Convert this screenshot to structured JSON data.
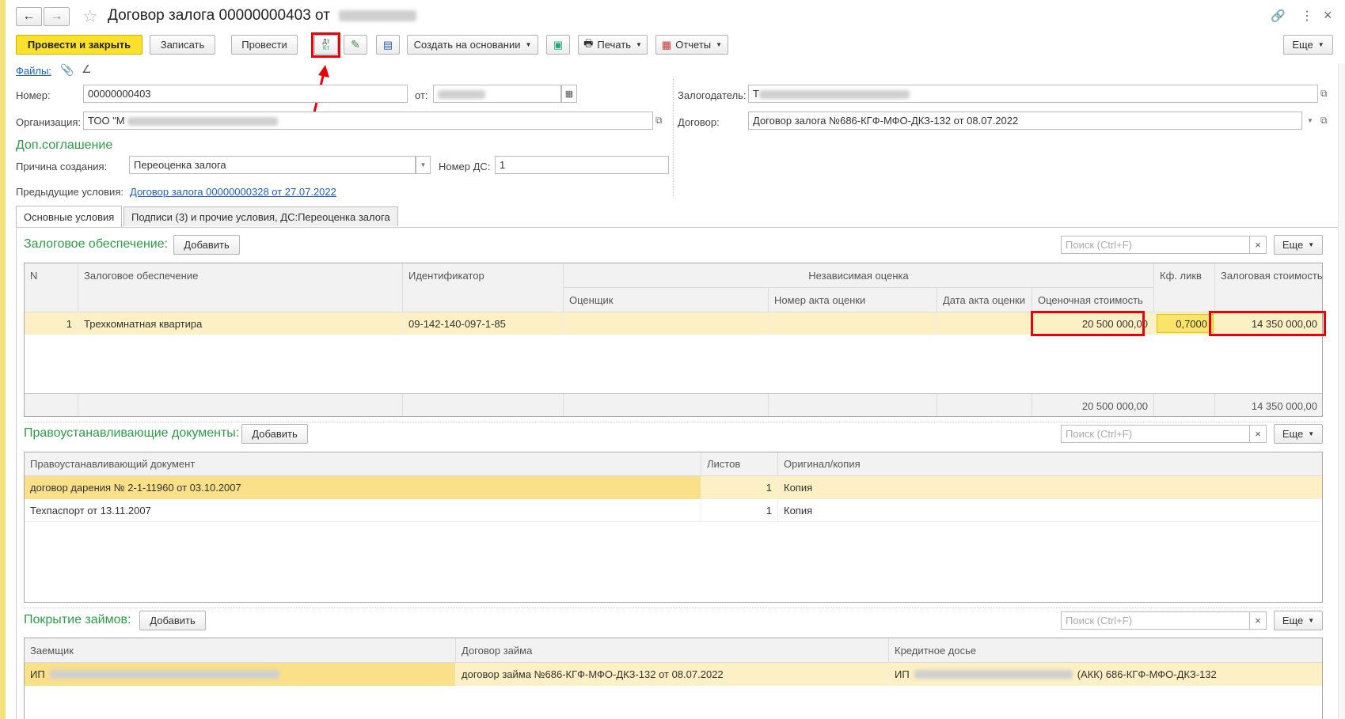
{
  "window": {
    "title": "Договор залога 00000000403 от"
  },
  "toolbar": {
    "post_close": "Провести и закрыть",
    "save": "Записать",
    "post": "Провести",
    "dtkt": "Дт Кт",
    "create_based": "Создать на основании",
    "print": "Печать",
    "reports": "Отчеты",
    "more": "Еще"
  },
  "files": {
    "label": "Файлы:"
  },
  "form": {
    "number_label": "Номер:",
    "number": "00000000403",
    "date_label": "от:",
    "org_label": "Организация:",
    "org_value": "ТОО \"М",
    "pledger_label": "Залогодатель:",
    "pledger_value": "Т",
    "contract_label": "Договор:",
    "contract_value": "Договор залога №686-КГФ-МФО-ДКЗ-132 от 08.07.2022",
    "addl_title": "Доп.соглашение",
    "reason_label": "Причина создания:",
    "reason_value": "Переоценка залога",
    "ds_label": "Номер ДС:",
    "ds_value": "1",
    "prev_label": "Предыдущие условия:",
    "prev_link": "Договор залога 00000000328 от 27.07.2022"
  },
  "tabs": [
    {
      "label": "Основные условия"
    },
    {
      "label": "Подписи (3) и прочие условия, ДС:Переоценка залога"
    }
  ],
  "collateral": {
    "title": "Залоговое обеспечение:",
    "add": "Добавить",
    "search_placeholder": "Поиск (Ctrl+F)",
    "clear": "×",
    "more": "Еще",
    "headers": {
      "n": "N",
      "item": "Залоговое обеспечение",
      "id": "Идентификатор",
      "indep": "Независимая оценка",
      "appraiser": "Оценщик",
      "act_no": "Номер акта оценки",
      "act_date": "Дата акта оценки",
      "est_value": "Оценочная стоимость",
      "kf": "Кф. ликв",
      "pledge_value": "Залоговая стоимость"
    },
    "rows": [
      {
        "n": "1",
        "item": "Трехкомнатная квартира",
        "id": "09-142-140-097-1-85",
        "appraiser": "",
        "act_no": "",
        "act_date": "",
        "est_value": "20 500 000,00",
        "kf": "0,7000",
        "pledge_value": "14 350 000,00"
      }
    ],
    "totals": {
      "est_value": "20 500 000,00",
      "pledge_value": "14 350 000,00"
    }
  },
  "title_docs": {
    "title": "Правоустанавливающие документы:",
    "add": "Добавить",
    "search_placeholder": "Поиск (Ctrl+F)",
    "clear": "×",
    "more": "Еще",
    "headers": {
      "doc": "Правоустанавливающий документ",
      "sheets": "Листов",
      "orig": "Оригинал/копия"
    },
    "rows": [
      {
        "doc": "договор дарения № 2-1-11960 от 03.10.2007",
        "sheets": "1",
        "orig": "Копия"
      },
      {
        "doc": "Техпаспорт от 13.11.2007",
        "sheets": "1",
        "orig": "Копия"
      }
    ]
  },
  "loans": {
    "title": "Покрытие займов:",
    "add": "Добавить",
    "search_placeholder": "Поиск (Ctrl+F)",
    "clear": "×",
    "more": "Еще",
    "headers": {
      "borrower": "Заемщик",
      "loan": "Договор займа",
      "dossier": "Кредитное досье"
    },
    "rows": [
      {
        "borrower": "ИП",
        "loan": "договор займа №686-КГФ-МФО-ДКЗ-132 от 08.07.2022",
        "dossier_prefix": "ИП",
        "dossier_suffix": "(АКК) 686-КГФ-МФО-ДКЗ-132"
      }
    ]
  },
  "colors": {
    "accent_yellow": "#fbe12b",
    "section_green": "#2f9a48",
    "highlight_red": "#e8000b",
    "row_selected": "#fdf0c4"
  }
}
